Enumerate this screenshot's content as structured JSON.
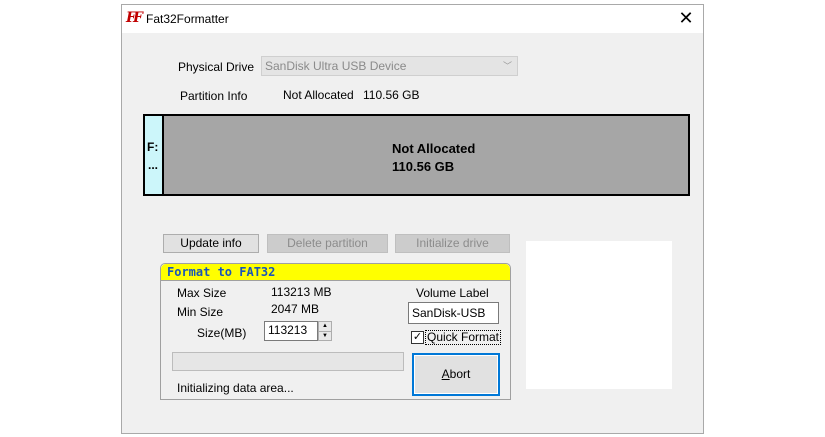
{
  "window": {
    "title": "Fat32Formatter",
    "icon": "fat32-app-icon",
    "close_glyph": "✕"
  },
  "drive": {
    "physical_drive_label": "Physical Drive",
    "physical_drive_value": "SanDisk Ultra USB Device",
    "partition_info_label": "Partition Info",
    "partition_info_status": "Not Allocated",
    "partition_info_size": "110.56 GB"
  },
  "disk_map": {
    "drive_letter": "F:",
    "drive_dots": "...",
    "partition_status": "Not Allocated",
    "partition_size": "110.56 GB",
    "colors": {
      "drive_cell": "#ccf6fa",
      "partition": "#a6a6a6"
    }
  },
  "actions": {
    "update_info": "Update info",
    "delete_partition": "Delete partition",
    "initialize_drive": "Initialize drive"
  },
  "format": {
    "title": "Format to FAT32",
    "max_size_label": "Max Size",
    "max_size_value": "113213 MB",
    "min_size_label": "Min Size",
    "min_size_value": "2047 MB",
    "size_label": "Size(MB)",
    "size_value": "113213",
    "volume_label_caption": "Volume Label",
    "volume_label_value": "SanDisk-USB",
    "quick_format_label": "Quick Format",
    "quick_format_checked": true,
    "check_glyph": "✓",
    "progress": 0,
    "status_text": "Initializing data area...",
    "abort_label_prefix": "A",
    "abort_label_rest": "bort",
    "colors": {
      "header_bg": "#ffff00",
      "title_text": "#1a56b8"
    }
  }
}
